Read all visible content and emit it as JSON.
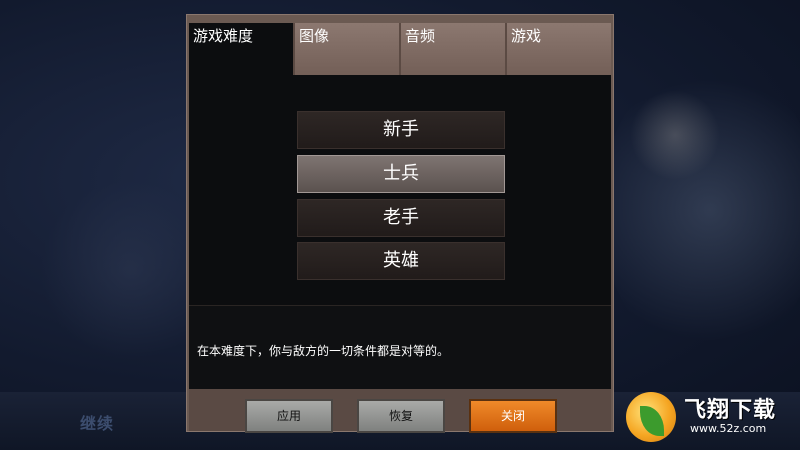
{
  "tabs": [
    {
      "label": "游戏难度",
      "active": true
    },
    {
      "label": "图像",
      "active": false
    },
    {
      "label": "音频",
      "active": false
    },
    {
      "label": "游戏",
      "active": false
    }
  ],
  "difficulty_options": [
    {
      "label": "新手",
      "selected": false
    },
    {
      "label": "士兵",
      "selected": true
    },
    {
      "label": "老手",
      "selected": false
    },
    {
      "label": "英雄",
      "selected": false
    }
  ],
  "description": "在本难度下，你与敌方的一切条件都是对等的。",
  "buttons": {
    "apply": "应用",
    "restore": "恢复",
    "close": "关闭"
  },
  "background": {
    "continue_label": "继续"
  },
  "watermark": {
    "title": "飞翔下载",
    "url": "www.52z.com"
  },
  "colors": {
    "dialog_frame": "#6b5a52",
    "content_bg": "#0c0d0f",
    "close_button": "#e8741a",
    "selected_option": "#6e6563"
  }
}
